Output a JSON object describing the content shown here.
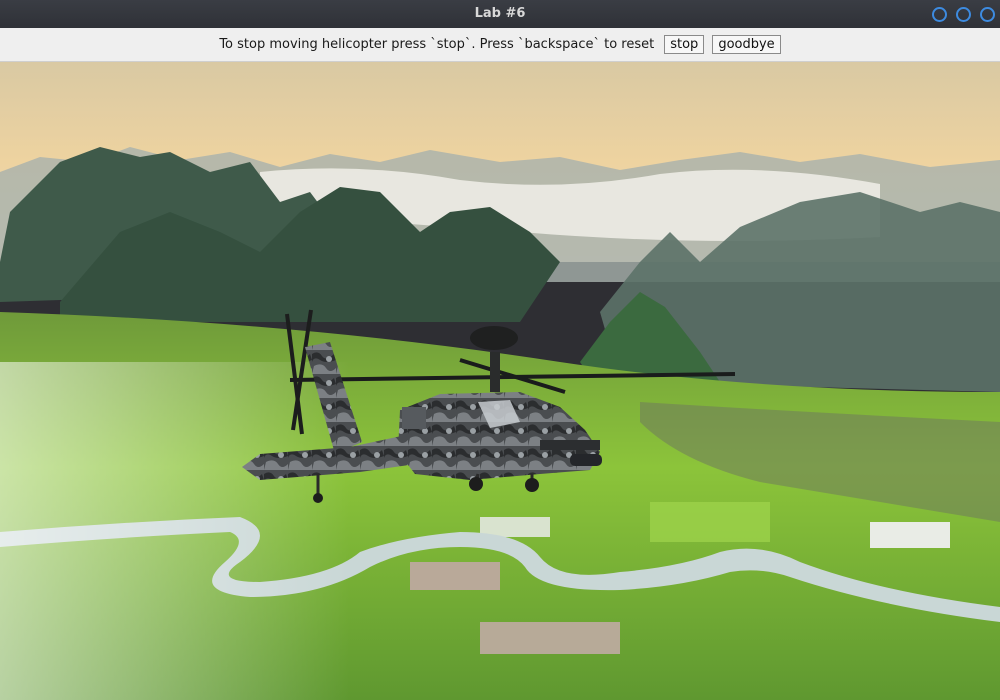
{
  "window": {
    "title": "Lab #6"
  },
  "toolbar": {
    "instructions": "To stop moving helicopter press `stop`. Press `backspace` to reset",
    "stop_label": "stop",
    "goodbye_label": "goodbye"
  },
  "scene": {
    "background": "aerial valley landscape with karst mountains, mist, rice paddies and a river",
    "object": "helicopter-3d-model"
  },
  "colors": {
    "window_control": "#3d8be0",
    "titlebar": "#2f3137",
    "toolbar": "#efefef"
  }
}
